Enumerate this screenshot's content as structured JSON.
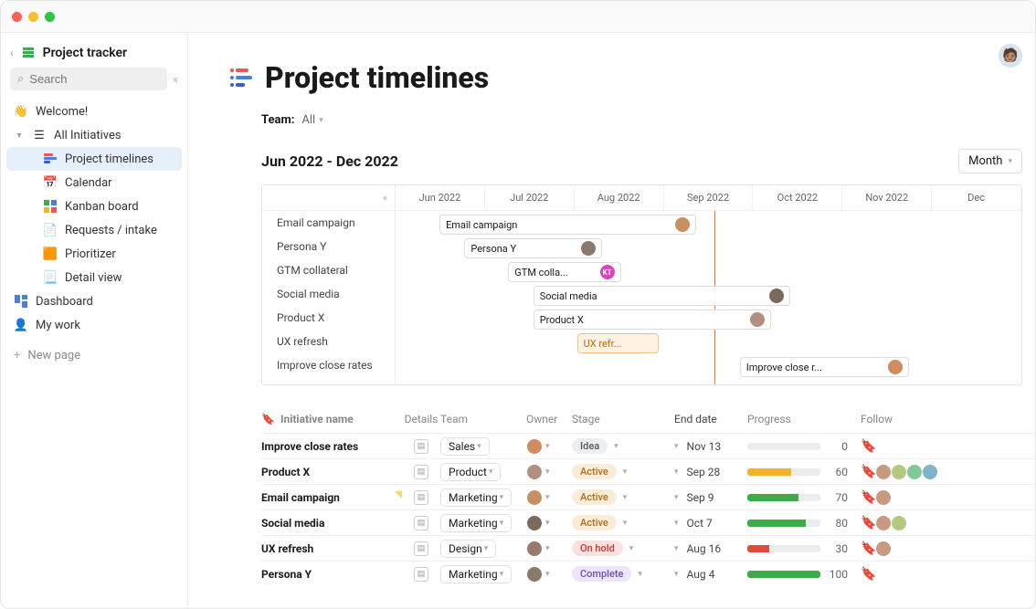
{
  "window": {
    "title": "Project tracker"
  },
  "sidebar": {
    "search_placeholder": "Search",
    "items": [
      {
        "label": "Welcome!",
        "icon": "👋"
      },
      {
        "label": "All Initiatives",
        "icon": "list",
        "expandable": true
      },
      {
        "label": "Project timelines",
        "icon": "timeline",
        "sub": true,
        "selected": true
      },
      {
        "label": "Calendar",
        "icon": "📅",
        "sub": true
      },
      {
        "label": "Kanban board",
        "icon": "kanban",
        "sub": true
      },
      {
        "label": "Requests / intake",
        "icon": "📄",
        "sub": true
      },
      {
        "label": "Prioritizer",
        "icon": "🟧",
        "sub": true
      },
      {
        "label": "Detail view",
        "icon": "📃",
        "sub": true
      },
      {
        "label": "Dashboard",
        "icon": "dashboard"
      },
      {
        "label": "My work",
        "icon": "👤"
      }
    ],
    "new_page": "New page"
  },
  "page": {
    "title": "Project timelines",
    "team_label": "Team:",
    "team_value": "All",
    "date_range": "Jun 2022 - Dec 2022",
    "month_label": "Month"
  },
  "gantt": {
    "months": [
      "Jun 2022",
      "Jul 2022",
      "Aug 2022",
      "Sep 2022",
      "Oct 2022",
      "Nov 2022",
      "Dec"
    ],
    "today_pct": 51,
    "rows": [
      {
        "name": "Email campaign",
        "label": "Email campaign",
        "start_pct": 7,
        "width_pct": 41,
        "avatar": "#c89060"
      },
      {
        "name": "Persona Y",
        "label": "Persona Y",
        "start_pct": 11,
        "width_pct": 22,
        "avatar": "#8a7a6a"
      },
      {
        "name": "GTM collateral",
        "label": "GTM colla...",
        "start_pct": 18,
        "width_pct": 18,
        "avatar_text": "KT",
        "avatar": "#d946b8"
      },
      {
        "name": "Social media",
        "label": "Social media",
        "start_pct": 22,
        "width_pct": 41,
        "avatar": "#7a6a5a"
      },
      {
        "name": "Product X",
        "label": "Product X",
        "start_pct": 22,
        "width_pct": 38,
        "avatar": "#b09080"
      },
      {
        "name": "UX refresh",
        "label": "UX refr...",
        "start_pct": 29,
        "width_pct": 13,
        "orange": true
      },
      {
        "name": "Improve close rates",
        "label": "Improve close r...",
        "start_pct": 55,
        "width_pct": 27,
        "avatar": "#d28a60"
      }
    ]
  },
  "table": {
    "headers": {
      "name": "Initiative name",
      "details": "Details",
      "team": "Team",
      "owner": "Owner",
      "stage": "Stage",
      "enddate": "End date",
      "progress": "Progress",
      "follow": "Follow"
    },
    "rows": [
      {
        "name": "Improve close rates",
        "team": "Sales",
        "stage": "Idea",
        "stage_cls": "stage-idea",
        "end": "Nov 13",
        "progress": 0,
        "color": "gray",
        "owner": "#d28a60",
        "followers": 0
      },
      {
        "name": "Product X",
        "team": "Product",
        "stage": "Active",
        "stage_cls": "stage-active",
        "end": "Sep 28",
        "progress": 60,
        "color": "yellow",
        "owner": "#b09080",
        "followers": 4
      },
      {
        "name": "Email campaign",
        "team": "Marketing",
        "stage": "Active",
        "stage_cls": "stage-active",
        "end": "Sep 9",
        "progress": 70,
        "color": "green",
        "owner": "#c89060",
        "followers": 1,
        "flag": true
      },
      {
        "name": "Social media",
        "team": "Marketing",
        "stage": "Active",
        "stage_cls": "stage-active",
        "end": "Oct 7",
        "progress": 80,
        "color": "green",
        "owner": "#7a6a5a",
        "followers": 2
      },
      {
        "name": "UX refresh",
        "team": "Design",
        "stage": "On hold",
        "stage_cls": "stage-hold",
        "end": "Aug 16",
        "progress": 30,
        "color": "red",
        "owner": "#9a7a6a",
        "followers": 1
      },
      {
        "name": "Persona Y",
        "team": "Marketing",
        "stage": "Complete",
        "stage_cls": "stage-complete",
        "end": "Aug 4",
        "progress": 100,
        "color": "green",
        "owner": "#8a7a6a",
        "followers": 0
      }
    ]
  }
}
